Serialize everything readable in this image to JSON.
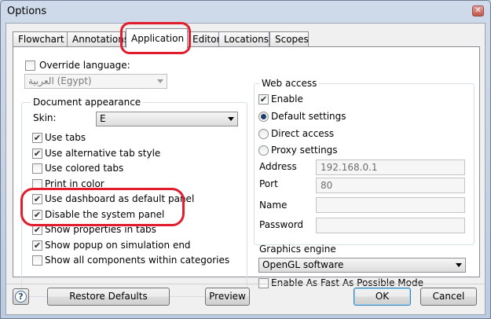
{
  "window": {
    "title": "Options",
    "close_glyph": "✕"
  },
  "tabs": [
    {
      "label": "Flowchart",
      "active": false
    },
    {
      "label": "Annotations",
      "active": false
    },
    {
      "label": "Application",
      "active": true
    },
    {
      "label": "Editor",
      "active": false
    },
    {
      "label": "Locations",
      "active": false
    },
    {
      "label": "Scopes",
      "active": false
    }
  ],
  "language": {
    "override_label": "Override language:",
    "override_checked": false,
    "selected": "العربية (Egypt)"
  },
  "appearance": {
    "group_title": "Document appearance",
    "skin_label": "Skin:",
    "skin_value": "E",
    "options": [
      {
        "label": "Use tabs",
        "checked": true
      },
      {
        "label": "Use alternative tab style",
        "checked": true
      },
      {
        "label": "Use colored tabs",
        "checked": false
      },
      {
        "label": "Print in color",
        "checked": false
      },
      {
        "label": "Use dashboard as default panel",
        "checked": true
      },
      {
        "label": "Disable the system panel",
        "checked": true
      },
      {
        "label": "Show properties in tabs",
        "checked": true
      },
      {
        "label": "Show popup on simulation end",
        "checked": true
      },
      {
        "label": "Show all components within categories",
        "checked": false
      }
    ]
  },
  "web_access": {
    "group_title": "Web access",
    "enable_label": "Enable",
    "enable_checked": true,
    "modes": [
      {
        "label": "Default settings",
        "selected": true
      },
      {
        "label": "Direct access",
        "selected": false
      },
      {
        "label": "Proxy settings",
        "selected": false
      }
    ],
    "fields": {
      "address_label": "Address",
      "address_value": "192.168.0.1",
      "port_label": "Port",
      "port_value": "80",
      "name_label": "Name",
      "name_value": "",
      "password_label": "Password",
      "password_value": ""
    }
  },
  "graphics": {
    "label": "Graphics engine",
    "selected": "OpenGL software",
    "fast_mode_label": "Enable As Fast As Possible Mode",
    "fast_mode_checked": false
  },
  "buttons": {
    "help_glyph": "?",
    "restore_defaults": "Restore Defaults",
    "preview": "Preview",
    "ok": "OK",
    "cancel": "Cancel"
  },
  "colors": {
    "annotation_red": "#e11d2d",
    "check_glyph": "✔"
  }
}
